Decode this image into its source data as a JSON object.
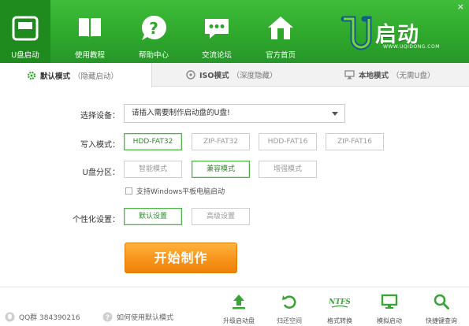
{
  "window": {
    "close_glyph": "×"
  },
  "nav": [
    {
      "label": "U盘启动",
      "icon": "usb-drive-icon",
      "active": true
    },
    {
      "label": "使用教程",
      "icon": "book-icon",
      "active": false
    },
    {
      "label": "帮助中心",
      "icon": "help-icon",
      "active": false
    },
    {
      "label": "交流论坛",
      "icon": "chat-icon",
      "active": false
    },
    {
      "label": "官方首页",
      "icon": "home-icon",
      "active": false
    }
  ],
  "brand": {
    "name": "启动",
    "url": "WWW.UQIDONG.COM",
    "logo_letter": "U"
  },
  "tabs": [
    {
      "name": "默认模式",
      "sub": "（隐藏启动）",
      "icon": "gear-icon",
      "active": true
    },
    {
      "name": "ISO模式",
      "sub": "（深度隐藏）",
      "icon": "disc-icon",
      "active": false
    },
    {
      "name": "本地模式",
      "sub": "（无需U盘）",
      "icon": "monitor-icon",
      "active": false
    }
  ],
  "form": {
    "device_label": "选择设备：",
    "device_value": "请插入需要制作启动盘的U盘!",
    "write_mode_label": "写入模式：",
    "write_modes": [
      "HDD-FAT32",
      "ZIP-FAT32",
      "HDD-FAT16",
      "ZIP-FAT16"
    ],
    "write_mode_selected": 0,
    "partition_label": "U盘分区：",
    "partitions": [
      "智能模式",
      "兼容模式",
      "增强模式"
    ],
    "partition_selected": 1,
    "tablet_checkbox_label": "支持Windows平板电脑启动",
    "tablet_checked": false,
    "personalize_label": "个性化设置：",
    "personalize_options": [
      "默认设置",
      "高级设置"
    ],
    "personalize_selected": 0,
    "start_button": "开始制作"
  },
  "footer": {
    "qq_group": "QQ群 384390216",
    "help_link": "如何使用默认模式",
    "tools": [
      {
        "label": "升级启动盘",
        "icon": "upgrade-icon"
      },
      {
        "label": "归还空间",
        "icon": "restore-icon"
      },
      {
        "label": "格式转换",
        "icon": "ntfs-icon",
        "icon_text": "NTFS"
      },
      {
        "label": "模拟启动",
        "icon": "simulate-boot-icon"
      },
      {
        "label": "快捷键查询",
        "icon": "search-icon"
      }
    ]
  },
  "colors": {
    "header_green": "#2ea62b",
    "accent_orange": "#f7931b",
    "selected_green": "#4fb34a"
  }
}
